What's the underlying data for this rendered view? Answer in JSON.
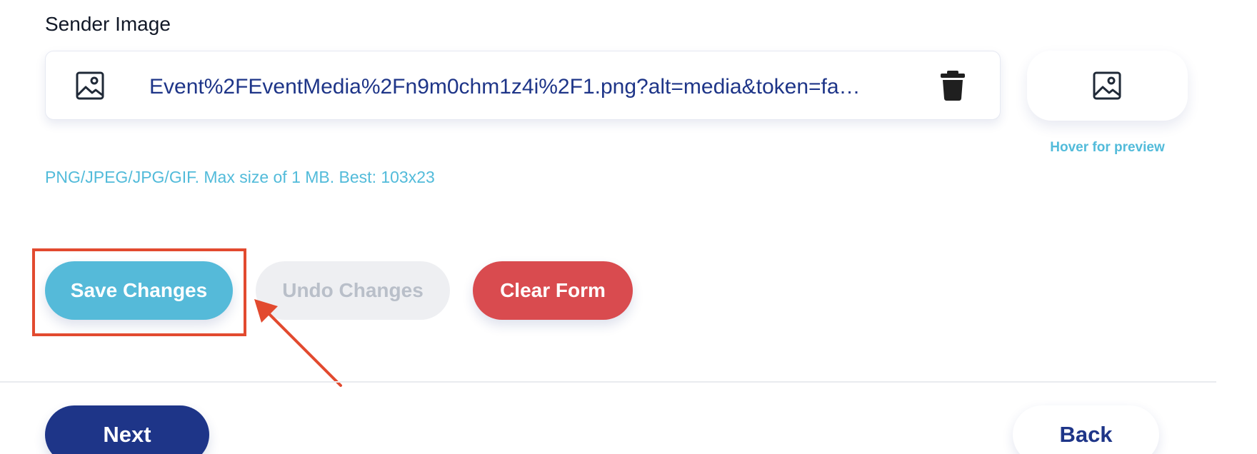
{
  "sender_image": {
    "label": "Sender Image",
    "file_name": "Event%2FEventMedia%2Fn9m0chm1z4i%2F1.png?alt=media&token=fa…",
    "left_icon": "image-icon",
    "delete_icon": "trash-icon",
    "preview_icon": "image-icon",
    "preview_hint": "Hover for preview",
    "help_text": "PNG/JPEG/JPG/GIF. Max size of 1 MB. Best: 103x23"
  },
  "actions": {
    "save_label": "Save Changes",
    "undo_label": "Undo Changes",
    "clear_label": "Clear Form"
  },
  "navigation": {
    "next_label": "Next",
    "back_label": "Back"
  },
  "colors": {
    "primary_navy": "#1e3588",
    "accent_cyan": "#55bad9",
    "danger_red": "#d94b4f",
    "disabled_gray": "#eeeff2",
    "annotation_red": "#e24a2f"
  }
}
